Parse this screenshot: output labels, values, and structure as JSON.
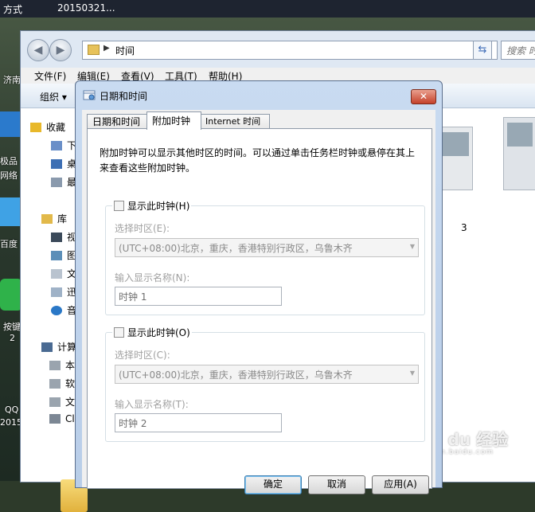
{
  "desktop": {
    "top_items": [
      "方式",
      "20150321..."
    ],
    "side_labels": [
      "济南",
      "极品",
      "网络",
      "百度",
      "按键",
      "2",
      "QQ",
      "2015"
    ]
  },
  "explorer": {
    "address": "时间",
    "search_placeholder": "搜索 时",
    "menu": [
      "文件(F)",
      "编辑(E)",
      "查看(V)",
      "工具(T)",
      "帮助(H)"
    ],
    "toolbar": {
      "organize": "组织 ▾"
    },
    "nav_items": [
      "收藏",
      "下",
      "桌",
      "最",
      "库",
      "视",
      "图",
      "文",
      "迅",
      "音",
      "计算",
      "本",
      "软",
      "文",
      "Cl"
    ],
    "thumb_label": "3"
  },
  "dialog": {
    "title": "日期和时间",
    "close_label": "✕",
    "tabs": [
      "日期和时间",
      "附加时钟",
      "Internet 时间"
    ],
    "description": "附加时钟可以显示其他时区的时间。可以通过单击任务栏时钟或悬停在其上来查看这些附加时钟。",
    "clock1": {
      "checkbox": "显示此时钟(H)",
      "timezone_label": "选择时区(E):",
      "timezone": "(UTC+08:00)北京，重庆，香港特别行政区，乌鲁木齐",
      "name_label": "输入显示名称(N):",
      "name": "时钟 1"
    },
    "clock2": {
      "checkbox": "显示此时钟(O)",
      "timezone_label": "选择时区(C):",
      "timezone": "(UTC+08:00)北京，重庆，香港特别行政区，乌鲁木齐",
      "name_label": "输入显示名称(T):",
      "name": "时钟 2"
    },
    "buttons": {
      "ok": "确定",
      "cancel": "取消",
      "apply": "应用(A)"
    }
  },
  "watermark": {
    "text": "Bai du 经验",
    "sub": "jingyan.baidu.com"
  },
  "colors": {
    "title_bar": "#c9dbf1",
    "close": "#c5412a",
    "accent": "#3c7fb1"
  }
}
